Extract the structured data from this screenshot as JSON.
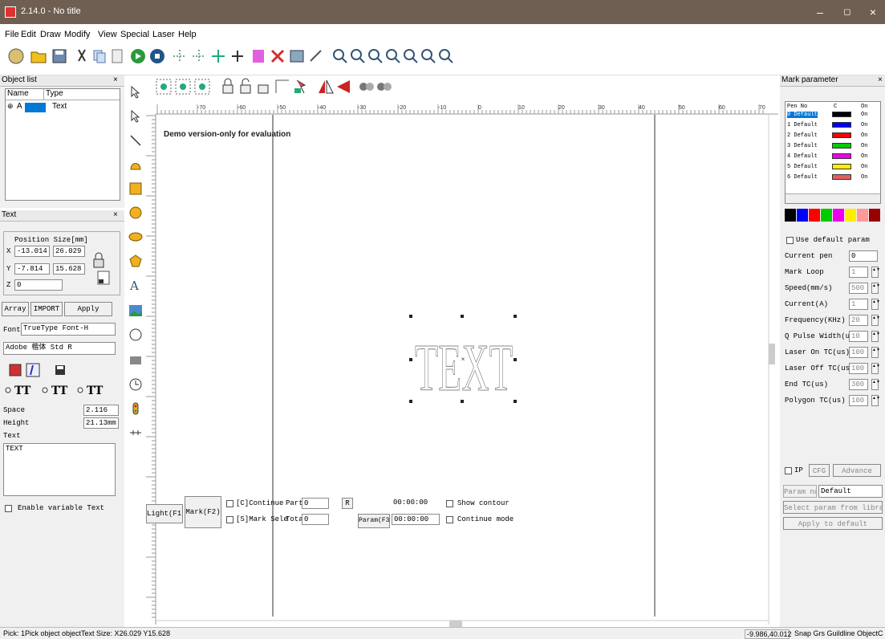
{
  "window": {
    "title": "2.14.0 - No title",
    "min": "–",
    "max": "◻",
    "close": "×"
  },
  "menu": [
    "File",
    "Edit",
    "Draw",
    "Modify",
    "View",
    "Special",
    "Laser",
    "Help"
  ],
  "object_list": {
    "title": "Object list",
    "close": "×",
    "col_name": "Name",
    "col_type": "Type",
    "row_name": "A",
    "row_type": "Text"
  },
  "text_panel": {
    "title": "Text",
    "close": "×",
    "hdr": "Position  Size[mm]",
    "x_label": "X",
    "x_pos": "-13.014",
    "x_size": "26.029",
    "y_label": "Y",
    "y_pos": "-7.814",
    "y_size": "15.628",
    "z_label": "Z",
    "z_pos": "0",
    "array_btn": "Array",
    "import_btn": "IMPORT",
    "apply_btn": "Apply",
    "font_label": "Font",
    "font_value": "TrueType Font-H",
    "font2_value": "Adobe 楷体 Std R",
    "space_label": "Space",
    "space_value": "2.116",
    "height_label": "Height",
    "height_value": "21.13mm",
    "text_label": "Text",
    "text_value": "TEXT",
    "enable_var": "Enable variable Text"
  },
  "canvas": {
    "demo_text": "Demo version-only for evaluation",
    "main_text": "TEXT",
    "ruler_labels": [
      "-70",
      "-60",
      "-50",
      "-40",
      "-30",
      "-20",
      "-10",
      "0",
      "10",
      "20",
      "30",
      "40",
      "50",
      "60",
      "70"
    ]
  },
  "mark_param": {
    "title": "Mark parameter",
    "close": "×",
    "col_pen": "Pen No",
    "col_c": "C",
    "col_on": "On",
    "pens": [
      {
        "label": "0 Default",
        "color": "#000000",
        "on": "On"
      },
      {
        "label": "1 Default",
        "color": "#0000ff",
        "on": "On"
      },
      {
        "label": "2 Default",
        "color": "#ff0000",
        "on": "On"
      },
      {
        "label": "3 Default",
        "color": "#00cc00",
        "on": "On"
      },
      {
        "label": "4 Default",
        "color": "#ee00ee",
        "on": "On"
      },
      {
        "label": "5 Default",
        "color": "#ffee00",
        "on": "On"
      },
      {
        "label": "6 Default",
        "color": "#e06060",
        "on": "On"
      }
    ],
    "palette": [
      "#000000",
      "#0000ff",
      "#ff0000",
      "#00cc00",
      "#ee00ee",
      "#ffee00",
      "#ff9999",
      "#990000"
    ],
    "use_default": "Use default param",
    "current_pen_label": "Current pen",
    "current_pen_value": "0",
    "params": [
      {
        "label": "Mark Loop",
        "value": "1"
      },
      {
        "label": "Speed(mm/s)",
        "value": "500"
      },
      {
        "label": "Current(A)",
        "value": "1"
      },
      {
        "label": "Frequency(KHz)",
        "value": "20"
      },
      {
        "label": "Q Pulse Width(u",
        "value": "10"
      },
      {
        "label": "Laser On TC(us)",
        "value": "100"
      },
      {
        "label": "Laser Off TC(us",
        "value": "100"
      },
      {
        "label": "End TC(us)",
        "value": "300"
      },
      {
        "label": "Polygon TC(us)",
        "value": "100"
      }
    ],
    "wobble_label": "IP",
    "cfg_btn": "CFG",
    "advance_btn": "Advance",
    "param_name_label": "Param name",
    "param_name_value": "Default",
    "select_lib": "Select param from library",
    "apply_default": "Apply to default"
  },
  "bottom": {
    "light_btn": "Light(F1)",
    "mark_btn": "Mark(F2)",
    "continue_label": "[C]Continue",
    "part_label": "Part",
    "part_value": "0",
    "r_btn": "R",
    "sel_label": "[S]Mark Sele",
    "total_label": "Total",
    "total_value": "0",
    "param_btn": "Param(F3)",
    "time1": "00:00:00",
    "time2": "00:00:00",
    "show_contour": "Show contour",
    "continue_mode": "Continue mode"
  },
  "status": {
    "left": "Pick: 1Pick object objectText Size: X26.029 Y15.628",
    "coords": "-9.986,40.012",
    "right": "Snap Grs Guildline ObjectC"
  }
}
